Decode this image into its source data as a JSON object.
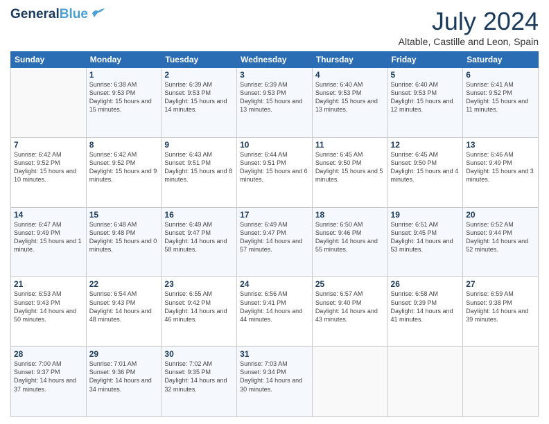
{
  "header": {
    "logo_line1": "General",
    "logo_line2": "Blue",
    "month_title": "July 2024",
    "subtitle": "Altable, Castille and Leon, Spain"
  },
  "days_of_week": [
    "Sunday",
    "Monday",
    "Tuesday",
    "Wednesday",
    "Thursday",
    "Friday",
    "Saturday"
  ],
  "weeks": [
    [
      {
        "day": "",
        "sunrise": "",
        "sunset": "",
        "daylight": ""
      },
      {
        "day": "1",
        "sunrise": "Sunrise: 6:38 AM",
        "sunset": "Sunset: 9:53 PM",
        "daylight": "Daylight: 15 hours and 15 minutes."
      },
      {
        "day": "2",
        "sunrise": "Sunrise: 6:39 AM",
        "sunset": "Sunset: 9:53 PM",
        "daylight": "Daylight: 15 hours and 14 minutes."
      },
      {
        "day": "3",
        "sunrise": "Sunrise: 6:39 AM",
        "sunset": "Sunset: 9:53 PM",
        "daylight": "Daylight: 15 hours and 13 minutes."
      },
      {
        "day": "4",
        "sunrise": "Sunrise: 6:40 AM",
        "sunset": "Sunset: 9:53 PM",
        "daylight": "Daylight: 15 hours and 13 minutes."
      },
      {
        "day": "5",
        "sunrise": "Sunrise: 6:40 AM",
        "sunset": "Sunset: 9:53 PM",
        "daylight": "Daylight: 15 hours and 12 minutes."
      },
      {
        "day": "6",
        "sunrise": "Sunrise: 6:41 AM",
        "sunset": "Sunset: 9:52 PM",
        "daylight": "Daylight: 15 hours and 11 minutes."
      }
    ],
    [
      {
        "day": "7",
        "sunrise": "Sunrise: 6:42 AM",
        "sunset": "Sunset: 9:52 PM",
        "daylight": "Daylight: 15 hours and 10 minutes."
      },
      {
        "day": "8",
        "sunrise": "Sunrise: 6:42 AM",
        "sunset": "Sunset: 9:52 PM",
        "daylight": "Daylight: 15 hours and 9 minutes."
      },
      {
        "day": "9",
        "sunrise": "Sunrise: 6:43 AM",
        "sunset": "Sunset: 9:51 PM",
        "daylight": "Daylight: 15 hours and 8 minutes."
      },
      {
        "day": "10",
        "sunrise": "Sunrise: 6:44 AM",
        "sunset": "Sunset: 9:51 PM",
        "daylight": "Daylight: 15 hours and 6 minutes."
      },
      {
        "day": "11",
        "sunrise": "Sunrise: 6:45 AM",
        "sunset": "Sunset: 9:50 PM",
        "daylight": "Daylight: 15 hours and 5 minutes."
      },
      {
        "day": "12",
        "sunrise": "Sunrise: 6:45 AM",
        "sunset": "Sunset: 9:50 PM",
        "daylight": "Daylight: 15 hours and 4 minutes."
      },
      {
        "day": "13",
        "sunrise": "Sunrise: 6:46 AM",
        "sunset": "Sunset: 9:49 PM",
        "daylight": "Daylight: 15 hours and 3 minutes."
      }
    ],
    [
      {
        "day": "14",
        "sunrise": "Sunrise: 6:47 AM",
        "sunset": "Sunset: 9:49 PM",
        "daylight": "Daylight: 15 hours and 1 minute."
      },
      {
        "day": "15",
        "sunrise": "Sunrise: 6:48 AM",
        "sunset": "Sunset: 9:48 PM",
        "daylight": "Daylight: 15 hours and 0 minutes."
      },
      {
        "day": "16",
        "sunrise": "Sunrise: 6:49 AM",
        "sunset": "Sunset: 9:47 PM",
        "daylight": "Daylight: 14 hours and 58 minutes."
      },
      {
        "day": "17",
        "sunrise": "Sunrise: 6:49 AM",
        "sunset": "Sunset: 9:47 PM",
        "daylight": "Daylight: 14 hours and 57 minutes."
      },
      {
        "day": "18",
        "sunrise": "Sunrise: 6:50 AM",
        "sunset": "Sunset: 9:46 PM",
        "daylight": "Daylight: 14 hours and 55 minutes."
      },
      {
        "day": "19",
        "sunrise": "Sunrise: 6:51 AM",
        "sunset": "Sunset: 9:45 PM",
        "daylight": "Daylight: 14 hours and 53 minutes."
      },
      {
        "day": "20",
        "sunrise": "Sunrise: 6:52 AM",
        "sunset": "Sunset: 9:44 PM",
        "daylight": "Daylight: 14 hours and 52 minutes."
      }
    ],
    [
      {
        "day": "21",
        "sunrise": "Sunrise: 6:53 AM",
        "sunset": "Sunset: 9:43 PM",
        "daylight": "Daylight: 14 hours and 50 minutes."
      },
      {
        "day": "22",
        "sunrise": "Sunrise: 6:54 AM",
        "sunset": "Sunset: 9:43 PM",
        "daylight": "Daylight: 14 hours and 48 minutes."
      },
      {
        "day": "23",
        "sunrise": "Sunrise: 6:55 AM",
        "sunset": "Sunset: 9:42 PM",
        "daylight": "Daylight: 14 hours and 46 minutes."
      },
      {
        "day": "24",
        "sunrise": "Sunrise: 6:56 AM",
        "sunset": "Sunset: 9:41 PM",
        "daylight": "Daylight: 14 hours and 44 minutes."
      },
      {
        "day": "25",
        "sunrise": "Sunrise: 6:57 AM",
        "sunset": "Sunset: 9:40 PM",
        "daylight": "Daylight: 14 hours and 43 minutes."
      },
      {
        "day": "26",
        "sunrise": "Sunrise: 6:58 AM",
        "sunset": "Sunset: 9:39 PM",
        "daylight": "Daylight: 14 hours and 41 minutes."
      },
      {
        "day": "27",
        "sunrise": "Sunrise: 6:59 AM",
        "sunset": "Sunset: 9:38 PM",
        "daylight": "Daylight: 14 hours and 39 minutes."
      }
    ],
    [
      {
        "day": "28",
        "sunrise": "Sunrise: 7:00 AM",
        "sunset": "Sunset: 9:37 PM",
        "daylight": "Daylight: 14 hours and 37 minutes."
      },
      {
        "day": "29",
        "sunrise": "Sunrise: 7:01 AM",
        "sunset": "Sunset: 9:36 PM",
        "daylight": "Daylight: 14 hours and 34 minutes."
      },
      {
        "day": "30",
        "sunrise": "Sunrise: 7:02 AM",
        "sunset": "Sunset: 9:35 PM",
        "daylight": "Daylight: 14 hours and 32 minutes."
      },
      {
        "day": "31",
        "sunrise": "Sunrise: 7:03 AM",
        "sunset": "Sunset: 9:34 PM",
        "daylight": "Daylight: 14 hours and 30 minutes."
      },
      {
        "day": "",
        "sunrise": "",
        "sunset": "",
        "daylight": ""
      },
      {
        "day": "",
        "sunrise": "",
        "sunset": "",
        "daylight": ""
      },
      {
        "day": "",
        "sunrise": "",
        "sunset": "",
        "daylight": ""
      }
    ]
  ]
}
